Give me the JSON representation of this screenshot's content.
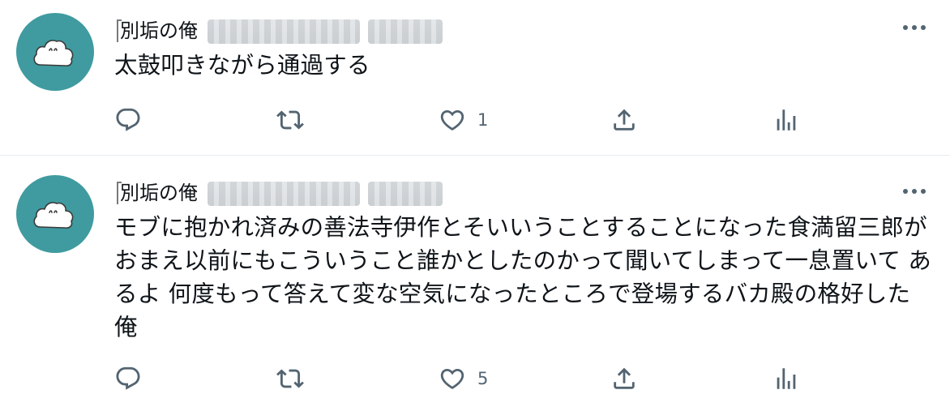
{
  "colors": {
    "avatar_bg": "#3f9ba0",
    "icon": "#536471",
    "text": "#0f1419",
    "divider": "#e6ecf0"
  },
  "icons": [
    "reply-icon",
    "retweet-icon",
    "like-icon",
    "share-icon",
    "analytics-icon",
    "more-icon"
  ],
  "tweets": [
    {
      "author_name": "別垢の俺",
      "text": "太鼓叩きながら通過する",
      "likes": "1"
    },
    {
      "author_name": "別垢の俺",
      "text": "モブに抱かれ済みの善法寺伊作とそいいうことすることになった食満留三郎が おまえ以前にもこういうこと誰かとしたのかって聞いてしまって一息置いて あるよ 何度もって答えて変な空気になったところで登場するバカ殿の格好した俺",
      "likes": "5"
    }
  ]
}
